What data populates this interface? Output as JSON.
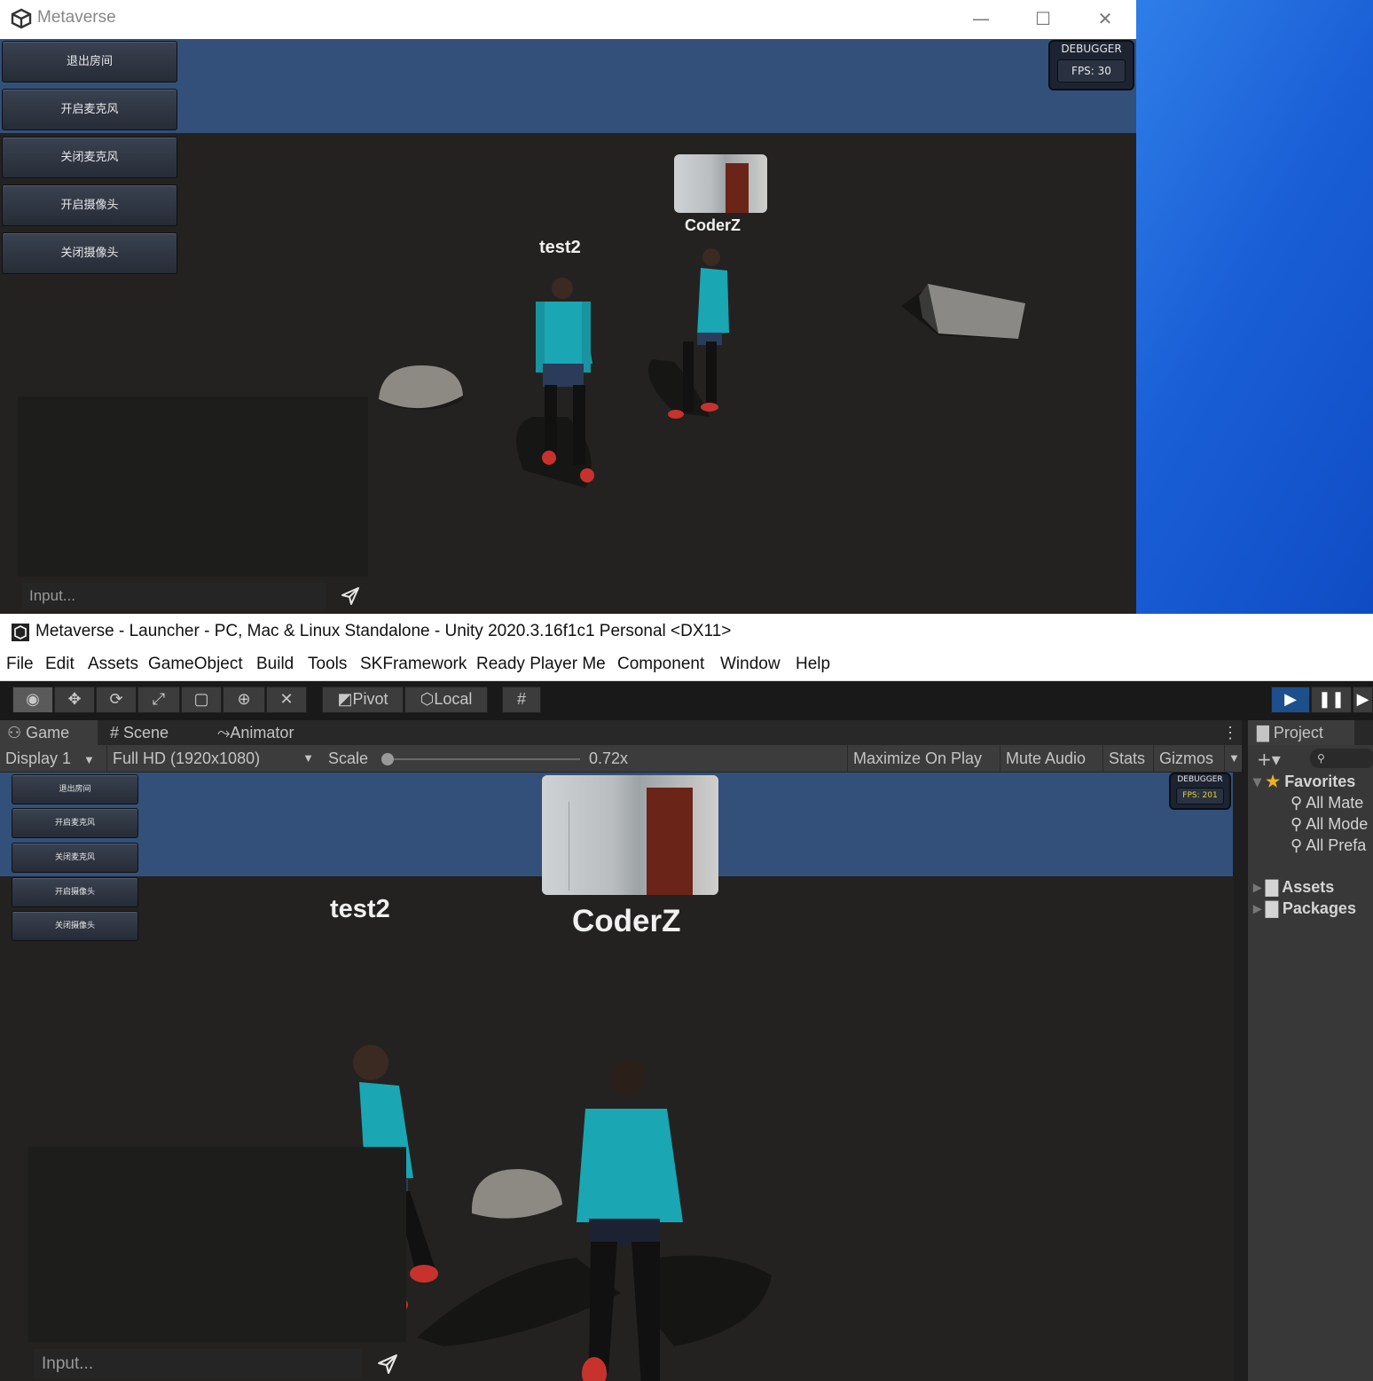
{
  "standalone": {
    "title": "Metaverse",
    "buttons": [
      "退出房间",
      "开启麦克风",
      "关闭麦克风",
      "开启摄像头",
      "关闭摄像头"
    ],
    "debugger_label": "DEBUGGER",
    "fps_text": "FPS: 30",
    "chat_placeholder": "Input...",
    "players": [
      {
        "name": "test2"
      },
      {
        "name": "CoderZ"
      }
    ]
  },
  "editor": {
    "title": "Metaverse - Launcher - PC, Mac & Linux Standalone - Unity 2020.3.16f1c1 Personal <DX11>",
    "menu": [
      "File",
      "Edit",
      "Assets",
      "GameObject",
      "Build",
      "Tools",
      "SKFramework",
      "Ready Player Me",
      "Component",
      "Window",
      "Help"
    ],
    "toolbar": {
      "pivot": "Pivot",
      "local": "Local"
    },
    "tabs": {
      "game": "Game",
      "scene": "Scene",
      "animator": "Animator"
    },
    "game_controls": {
      "display": "Display 1",
      "resolution": "Full HD (1920x1080)",
      "scale_label": "Scale",
      "scale_value": "0.72x",
      "maximize": "Maximize On Play",
      "mute": "Mute Audio",
      "stats": "Stats",
      "gizmos": "Gizmos"
    },
    "scale_fraction": 0.0,
    "game": {
      "buttons": [
        "退出房间",
        "开启麦克风",
        "关闭麦克风",
        "开启摄像头",
        "关闭摄像头"
      ],
      "debugger_label": "DEBUGGER",
      "fps_text": "FPS: 201",
      "chat_placeholder": "Input...",
      "players": [
        {
          "name": "test2"
        },
        {
          "name": "CoderZ"
        }
      ]
    },
    "project": {
      "tab": "Project",
      "favorites": "Favorites",
      "favorite_items": [
        "All Mate",
        "All Mode",
        "All Prefa"
      ],
      "folders": [
        "Assets",
        "Packages"
      ]
    }
  },
  "colors": {
    "sky": "#33507a",
    "ground": "#232220",
    "fps_yellow": "#e8d23a",
    "play_active": "#1c4f8c"
  }
}
